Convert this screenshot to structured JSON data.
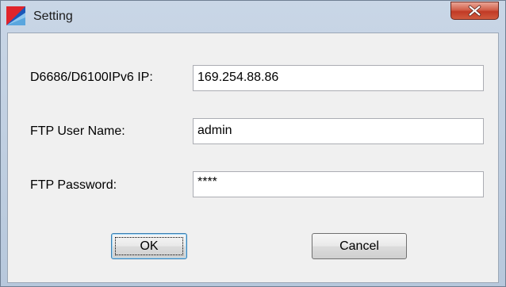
{
  "window": {
    "title": "Setting",
    "app_icon": "app-logo-icon",
    "close_icon": "close-icon"
  },
  "form": {
    "ip_label": "D6686/D6100IPv6 IP:",
    "ip_value": "169.254.88.86",
    "username_label": "FTP User Name:",
    "username_value": "admin",
    "password_label": "FTP Password:",
    "password_value": "****"
  },
  "buttons": {
    "ok_label": "OK",
    "cancel_label": "Cancel"
  },
  "colors": {
    "close_button": "#c13a25",
    "dialog_background": "#f0f0f0"
  }
}
